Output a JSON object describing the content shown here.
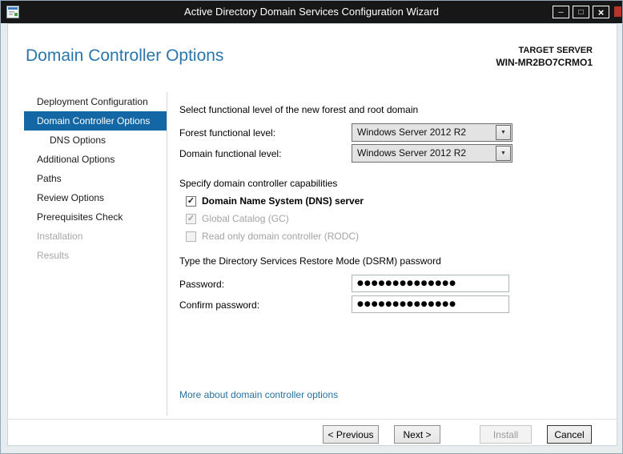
{
  "window": {
    "title": "Active Directory Domain Services Configuration Wizard"
  },
  "header": {
    "page_title": "Domain Controller Options",
    "target_server_label": "TARGET SERVER",
    "target_server_name": "WIN-MR2BO7CRMO1"
  },
  "sidebar": {
    "items": [
      {
        "label": "Deployment Configuration",
        "state": "normal"
      },
      {
        "label": "Domain Controller Options",
        "state": "selected"
      },
      {
        "label": "DNS Options",
        "state": "normal",
        "indent": true
      },
      {
        "label": "Additional Options",
        "state": "normal"
      },
      {
        "label": "Paths",
        "state": "normal"
      },
      {
        "label": "Review Options",
        "state": "normal"
      },
      {
        "label": "Prerequisites Check",
        "state": "normal"
      },
      {
        "label": "Installation",
        "state": "disabled"
      },
      {
        "label": "Results",
        "state": "disabled"
      }
    ]
  },
  "content": {
    "functional_level_heading": "Select functional level of the new forest and root domain",
    "forest_label": "Forest functional level:",
    "forest_value": "Windows Server 2012 R2",
    "domain_label": "Domain functional level:",
    "domain_value": "Windows Server 2012 R2",
    "capabilities_heading": "Specify domain controller capabilities",
    "checkboxes": [
      {
        "label": "Domain Name System (DNS) server",
        "checked": true,
        "enabled": true
      },
      {
        "label": "Global Catalog (GC)",
        "checked": true,
        "enabled": false
      },
      {
        "label": "Read only domain controller (RODC)",
        "checked": false,
        "enabled": false
      }
    ],
    "dsrm_heading": "Type the Directory Services Restore Mode (DSRM) password",
    "password_label": "Password:",
    "password_value": "●●●●●●●●●●●●●●",
    "confirm_label": "Confirm password:",
    "confirm_value": "●●●●●●●●●●●●●●",
    "more_link": "More about domain controller options"
  },
  "footer": {
    "previous_label": "< Previous",
    "next_label": "Next >",
    "install_label": "Install",
    "cancel_label": "Cancel"
  },
  "icons": {
    "minimize": "─",
    "maximize": "□",
    "close": "×",
    "dropdown": "▼",
    "check": "✓"
  },
  "colors": {
    "accent_blue": "#2a76ac",
    "selected_nav": "#1467a5",
    "titlebar": "#171717"
  }
}
